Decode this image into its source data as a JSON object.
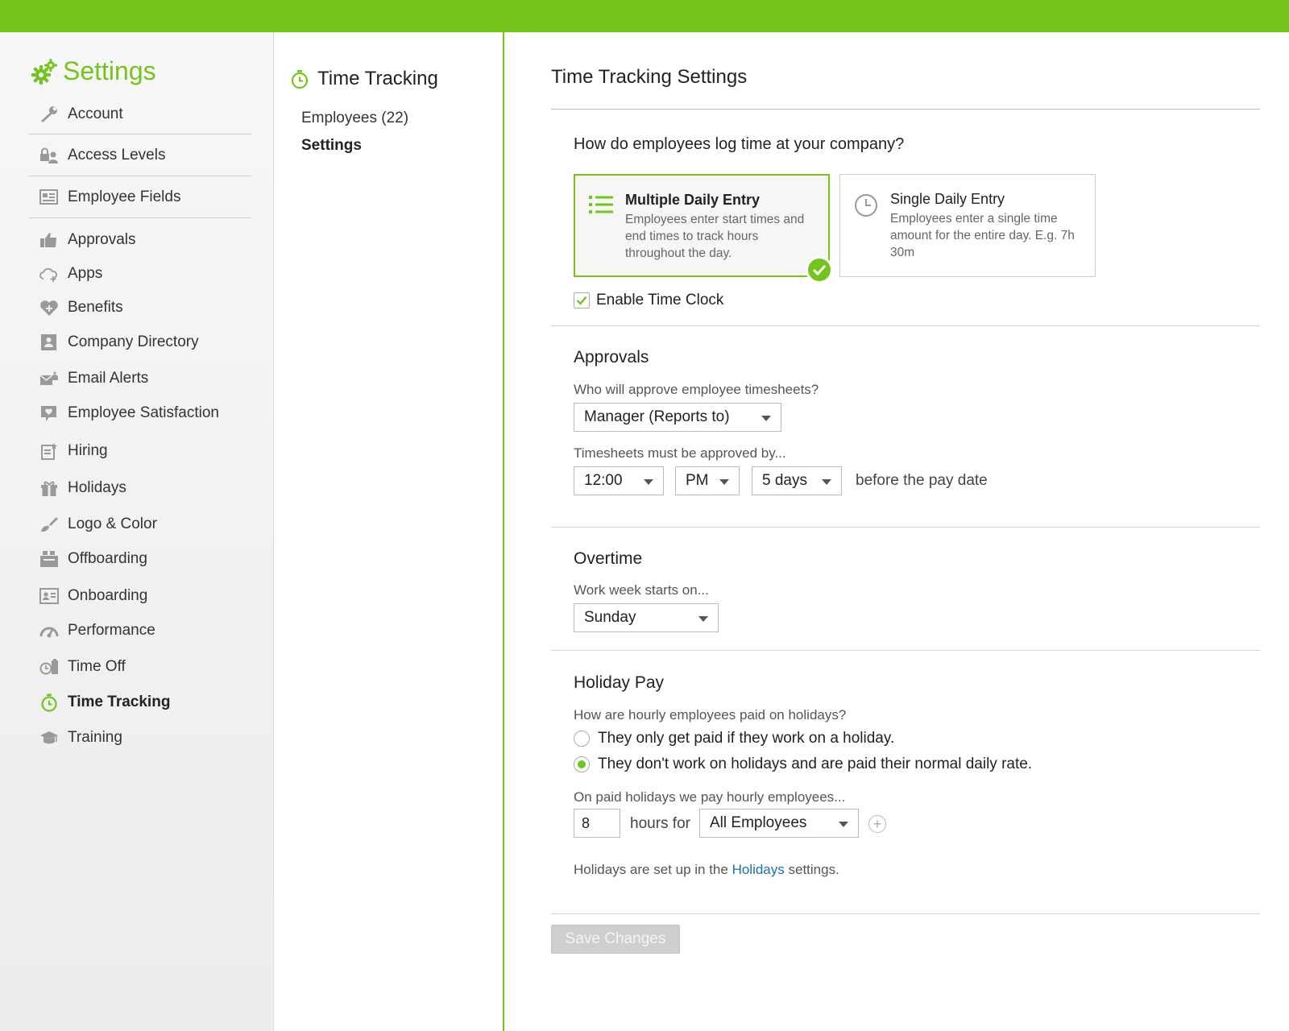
{
  "sidebar": {
    "title": "Settings",
    "items": [
      {
        "label": "Account",
        "icon": "wrench-icon"
      },
      {
        "label": "Access Levels",
        "icon": "lock-user-icon"
      },
      {
        "label": "Employee Fields",
        "icon": "fields-list-icon"
      },
      {
        "label": "Approvals",
        "icon": "thumbs-up-icon"
      },
      {
        "label": "Apps",
        "icon": "cloud-plus-icon"
      },
      {
        "label": "Benefits",
        "icon": "heart-plus-icon"
      },
      {
        "label": "Company Directory",
        "icon": "directory-icon"
      },
      {
        "label": "Email Alerts",
        "icon": "envelope-bell-icon"
      },
      {
        "label": "Employee Satisfaction",
        "icon": "chat-heart-icon"
      },
      {
        "label": "Hiring",
        "icon": "hiring-icon"
      },
      {
        "label": "Holidays",
        "icon": "gift-icon"
      },
      {
        "label": "Logo & Color",
        "icon": "paintbrush-icon"
      },
      {
        "label": "Offboarding",
        "icon": "offboarding-icon"
      },
      {
        "label": "Onboarding",
        "icon": "id-card-icon"
      },
      {
        "label": "Performance",
        "icon": "gauge-icon"
      },
      {
        "label": "Time Off",
        "icon": "time-off-icon"
      },
      {
        "label": "Time Tracking",
        "icon": "stopwatch-icon",
        "active": true
      },
      {
        "label": "Training",
        "icon": "graduation-cap-icon"
      }
    ]
  },
  "subnav": {
    "title": "Time Tracking",
    "links": [
      {
        "label": "Employees (22)"
      },
      {
        "label": "Settings",
        "active": true
      }
    ]
  },
  "main": {
    "title": "Time Tracking Settings",
    "log_question": "How do employees log time at your company?",
    "options": [
      {
        "title": "Multiple Daily Entry",
        "desc": "Employees enter start times and end times to track hours throughout the day.",
        "selected": true
      },
      {
        "title": "Single Daily Entry",
        "desc": "Employees enter a single time amount for the entire day. E.g. 7h 30m",
        "selected": false
      }
    ],
    "time_clock": {
      "label": "Enable Time Clock",
      "checked": true
    },
    "approvals": {
      "heading": "Approvals",
      "who_label": "Who will approve employee timesheets?",
      "approver": "Manager (Reports to)",
      "deadline_label": "Timesheets must be approved by...",
      "time": "12:00",
      "ampm": "PM",
      "days": "5 days",
      "suffix": "before the pay date"
    },
    "overtime": {
      "heading": "Overtime",
      "week_label": "Work week starts on...",
      "week_start": "Sunday"
    },
    "holiday_pay": {
      "heading": "Holiday Pay",
      "question": "How are hourly employees paid on holidays?",
      "radio_1": "They only get paid if they work on a holiday.",
      "radio_2": "They don't work on holidays and are paid their normal daily rate.",
      "selected_radio": 2,
      "pay_label": "On paid holidays we pay hourly employees...",
      "hours": "8",
      "hours_for": "hours for",
      "group": "All Employees",
      "note_prefix": "Holidays are set up in the ",
      "note_link": "Holidays",
      "note_suffix": " settings."
    },
    "save_label": "Save Changes"
  },
  "colors": {
    "accent": "#73c41d",
    "link": "#1a6fb3"
  }
}
